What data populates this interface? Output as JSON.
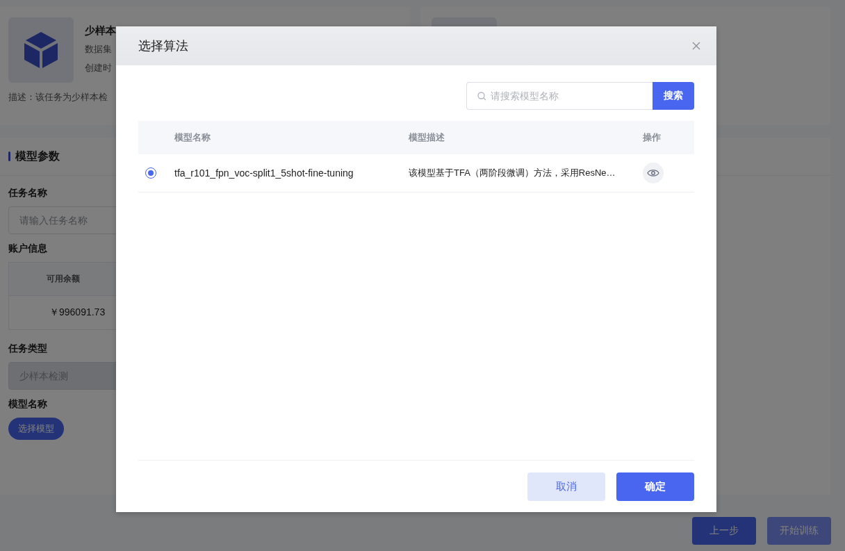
{
  "page": {
    "task_card": {
      "title": "少样本",
      "dataset": "数据集",
      "created": "创建时",
      "description": "描述：该任务为少样本检"
    },
    "section_title": "模型参数",
    "fields": [
      {
        "kind": "input",
        "label": "任务名称",
        "placeholder": "请输入任务名称",
        "disabled": false
      },
      {
        "kind": "table",
        "label": "账户信息",
        "column": "可用余额",
        "value": "￥996091.73"
      },
      {
        "kind": "input",
        "label": "任务类型",
        "placeholder": "少样本检测",
        "disabled": true
      },
      {
        "kind": "button",
        "label": "模型名称",
        "button": "选择模型"
      }
    ],
    "footer_buttons": [
      {
        "label": "上一步",
        "disabled": false
      },
      {
        "label": "开始训练",
        "disabled": true
      }
    ]
  },
  "dialog": {
    "title": "选择算法",
    "search": {
      "placeholder": "请搜索模型名称",
      "button": "搜索"
    },
    "table": {
      "columns": [
        "模型名称",
        "模型描述",
        "操作"
      ],
      "rows": [
        {
          "selected": true,
          "name": "tfa_r101_fpn_voc-split1_5shot-fine-tuning",
          "description": "该模型基于TFA（两阶段微调）方法，采用ResNe…"
        }
      ]
    },
    "buttons": [
      {
        "label": "取消",
        "kind": "secondary"
      },
      {
        "label": "确定",
        "kind": "primary"
      }
    ]
  }
}
